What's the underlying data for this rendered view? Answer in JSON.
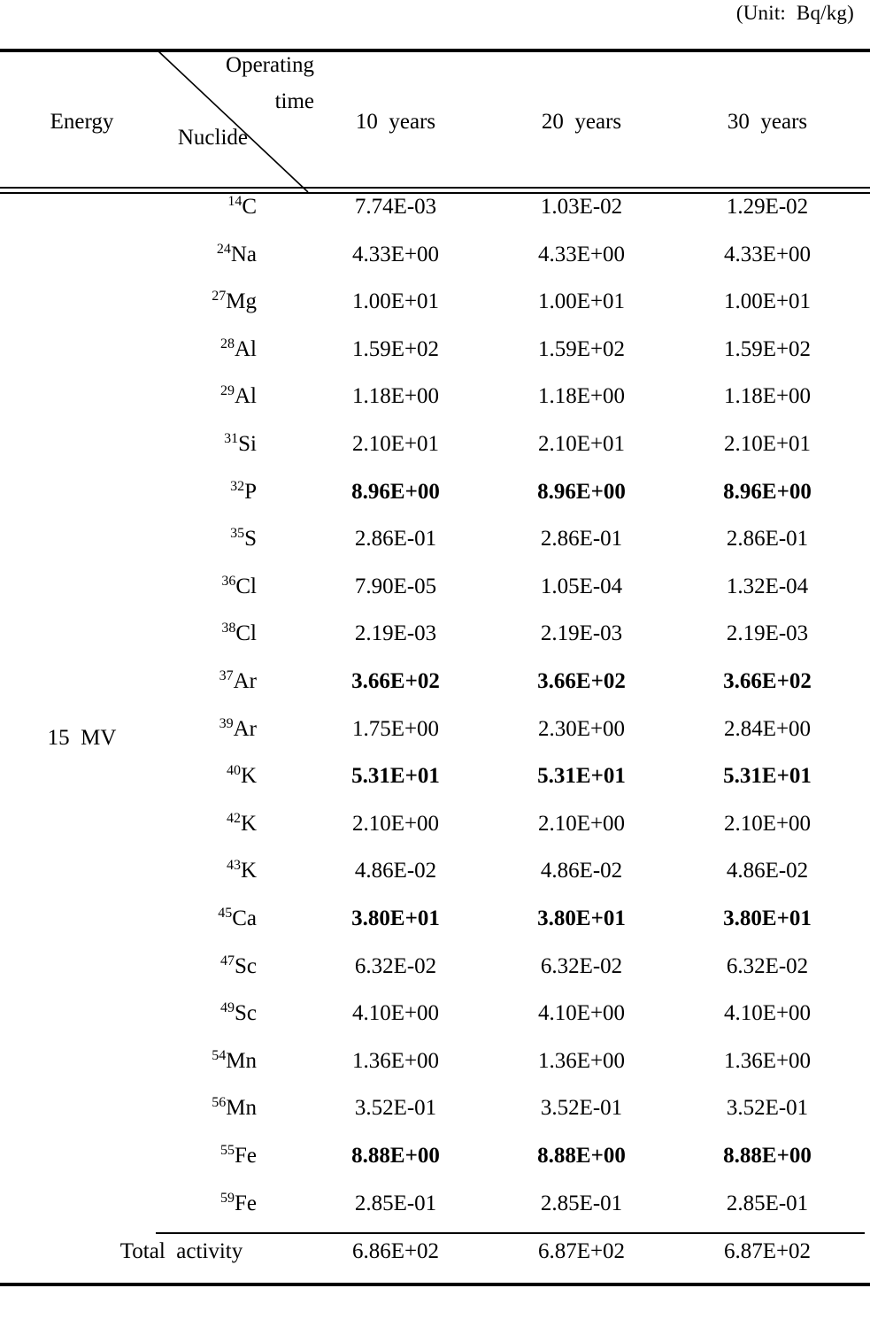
{
  "unit_caption": "(Unit:  Bq/kg)",
  "header": {
    "energy_label": "Energy",
    "operating_time_line1": "Operating",
    "operating_time_line2": "time",
    "nuclide_label": "Nuclide",
    "columns": [
      "10  years",
      "20  years",
      "30  years"
    ]
  },
  "energy_row_label": "15  MV",
  "total": {
    "label": "Total  activity",
    "values": [
      "6.86E+02",
      "6.87E+02",
      "6.87E+02"
    ]
  },
  "chart_data": {
    "type": "table",
    "title": "Activation nuclide activity by operating time",
    "unit": "Bq/kg",
    "energy": "15 MV",
    "row_header": "Nuclide",
    "column_header": "Operating time",
    "categories": [
      "10 years",
      "20 years",
      "30 years"
    ],
    "rows": [
      {
        "mass": "14",
        "element": "C",
        "bold": false,
        "values": [
          "7.74E-03",
          "1.03E-02",
          "1.29E-02"
        ]
      },
      {
        "mass": "24",
        "element": "Na",
        "bold": false,
        "values": [
          "4.33E+00",
          "4.33E+00",
          "4.33E+00"
        ]
      },
      {
        "mass": "27",
        "element": "Mg",
        "bold": false,
        "values": [
          "1.00E+01",
          "1.00E+01",
          "1.00E+01"
        ]
      },
      {
        "mass": "28",
        "element": "Al",
        "bold": false,
        "values": [
          "1.59E+02",
          "1.59E+02",
          "1.59E+02"
        ]
      },
      {
        "mass": "29",
        "element": "Al",
        "bold": false,
        "values": [
          "1.18E+00",
          "1.18E+00",
          "1.18E+00"
        ]
      },
      {
        "mass": "31",
        "element": "Si",
        "bold": false,
        "values": [
          "2.10E+01",
          "2.10E+01",
          "2.10E+01"
        ]
      },
      {
        "mass": "32",
        "element": "P",
        "bold": true,
        "values": [
          "8.96E+00",
          "8.96E+00",
          "8.96E+00"
        ]
      },
      {
        "mass": "35",
        "element": "S",
        "bold": false,
        "values": [
          "2.86E-01",
          "2.86E-01",
          "2.86E-01"
        ]
      },
      {
        "mass": "36",
        "element": "Cl",
        "bold": false,
        "values": [
          "7.90E-05",
          "1.05E-04",
          "1.32E-04"
        ]
      },
      {
        "mass": "38",
        "element": "Cl",
        "bold": false,
        "values": [
          "2.19E-03",
          "2.19E-03",
          "2.19E-03"
        ]
      },
      {
        "mass": "37",
        "element": "Ar",
        "bold": true,
        "values": [
          "3.66E+02",
          "3.66E+02",
          "3.66E+02"
        ]
      },
      {
        "mass": "39",
        "element": "Ar",
        "bold": false,
        "values": [
          "1.75E+00",
          "2.30E+00",
          "2.84E+00"
        ]
      },
      {
        "mass": "40",
        "element": "K",
        "bold": true,
        "values": [
          "5.31E+01",
          "5.31E+01",
          "5.31E+01"
        ]
      },
      {
        "mass": "42",
        "element": "K",
        "bold": false,
        "values": [
          "2.10E+00",
          "2.10E+00",
          "2.10E+00"
        ]
      },
      {
        "mass": "43",
        "element": "K",
        "bold": false,
        "values": [
          "4.86E-02",
          "4.86E-02",
          "4.86E-02"
        ]
      },
      {
        "mass": "45",
        "element": "Ca",
        "bold": true,
        "values": [
          "3.80E+01",
          "3.80E+01",
          "3.80E+01"
        ]
      },
      {
        "mass": "47",
        "element": "Sc",
        "bold": false,
        "values": [
          "6.32E-02",
          "6.32E-02",
          "6.32E-02"
        ]
      },
      {
        "mass": "49",
        "element": "Sc",
        "bold": false,
        "values": [
          "4.10E+00",
          "4.10E+00",
          "4.10E+00"
        ]
      },
      {
        "mass": "54",
        "element": "Mn",
        "bold": false,
        "values": [
          "1.36E+00",
          "1.36E+00",
          "1.36E+00"
        ]
      },
      {
        "mass": "56",
        "element": "Mn",
        "bold": false,
        "values": [
          "3.52E-01",
          "3.52E-01",
          "3.52E-01"
        ]
      },
      {
        "mass": "55",
        "element": "Fe",
        "bold": true,
        "values": [
          "8.88E+00",
          "8.88E+00",
          "8.88E+00"
        ]
      },
      {
        "mass": "59",
        "element": "Fe",
        "bold": false,
        "values": [
          "2.85E-01",
          "2.85E-01",
          "2.85E-01"
        ]
      }
    ],
    "total_label": "Total activity",
    "total_values": [
      "6.86E+02",
      "6.87E+02",
      "6.87E+02"
    ]
  }
}
